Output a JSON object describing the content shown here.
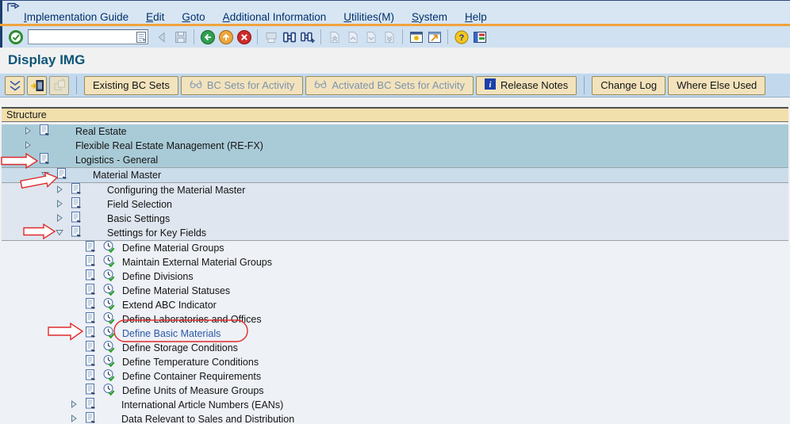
{
  "menubar": {
    "items": [
      "Implementation Guide",
      "Edit",
      "Goto",
      "Additional Information",
      "Utilities(M)",
      "System",
      "Help"
    ]
  },
  "toolbar": {
    "command_field": {
      "value": "",
      "placeholder": ""
    },
    "icon_names": [
      "enter-icon",
      "command-history-icon",
      "back-small-icon",
      "save-icon",
      "back-icon",
      "exit-icon",
      "cancel-icon",
      "print-icon",
      "find-icon",
      "find-next-icon",
      "first-page-icon",
      "previous-page-icon",
      "next-page-icon",
      "last-page-icon",
      "new-session-icon",
      "create-shortcut-icon",
      "help-icon",
      "customize-layout-icon"
    ]
  },
  "header": {
    "title": "Display IMG"
  },
  "app_toolbar": {
    "tools": [
      {
        "name": "choose",
        "icon": "double-chevron-down-icon",
        "disabled": false
      },
      {
        "name": "position",
        "icon": "position-window-icon",
        "disabled": false
      },
      {
        "name": "copy",
        "icon": "copy-icon",
        "disabled": true
      }
    ],
    "buttons": [
      {
        "label": "Existing BC Sets",
        "disabled": false
      },
      {
        "label": "BC Sets for Activity",
        "disabled": true,
        "icon": "glasses-icon"
      },
      {
        "label": "Activated BC Sets for Activity",
        "disabled": true,
        "icon": "glasses-icon"
      },
      {
        "label": "Release Notes",
        "disabled": false,
        "icon": "info-icon"
      },
      {
        "label": "Change Log",
        "disabled": false
      },
      {
        "label": "Where Else Used",
        "disabled": false
      }
    ]
  },
  "tree": {
    "header": "Structure",
    "bands": [
      {
        "rows": [
          {
            "label": "Real Estate",
            "level": 0,
            "expander": "collapsed",
            "icons": [
              "doc"
            ],
            "highlight": false
          },
          {
            "label": "Flexible Real Estate Management (RE-FX)",
            "level": 0,
            "expander": "collapsed",
            "icons": [],
            "highlight": false
          },
          {
            "label": "Logistics - General",
            "level": 0,
            "expander": "expanded",
            "icons": [
              "doc"
            ],
            "highlight": false
          }
        ]
      },
      {
        "rows": [
          {
            "label": "Material Master",
            "level": 1,
            "expander": "expanded",
            "icons": [
              "doc"
            ],
            "highlight": false
          }
        ]
      },
      {
        "rows": [
          {
            "label": "Configuring the Material Master",
            "level": 2,
            "expander": "collapsed",
            "icons": [
              "doc"
            ],
            "highlight": false
          },
          {
            "label": "Field Selection",
            "level": 2,
            "expander": "collapsed",
            "icons": [
              "doc"
            ],
            "highlight": false
          },
          {
            "label": "Basic Settings",
            "level": 2,
            "expander": "collapsed",
            "icons": [
              "doc"
            ],
            "highlight": false
          },
          {
            "label": "Settings for Key Fields",
            "level": 2,
            "expander": "expanded",
            "icons": [
              "doc"
            ],
            "highlight": false
          }
        ]
      },
      {
        "rows": [
          {
            "label": "Define Material Groups",
            "level": 3,
            "expander": null,
            "icons": [
              "doc",
              "exec"
            ],
            "highlight": false
          },
          {
            "label": "Maintain External Material Groups",
            "level": 3,
            "expander": null,
            "icons": [
              "doc",
              "exec"
            ],
            "highlight": false
          },
          {
            "label": "Define Divisions",
            "level": 3,
            "expander": null,
            "icons": [
              "doc",
              "exec"
            ],
            "highlight": false
          },
          {
            "label": "Define Material Statuses",
            "level": 3,
            "expander": null,
            "icons": [
              "doc",
              "exec"
            ],
            "highlight": false
          },
          {
            "label": "Extend ABC Indicator",
            "level": 3,
            "expander": null,
            "icons": [
              "doc",
              "exec"
            ],
            "highlight": false
          },
          {
            "label": "Define Laboratories and Offices",
            "level": 3,
            "expander": null,
            "icons": [
              "doc",
              "exec"
            ],
            "highlight": false
          },
          {
            "label": "Define Basic Materials",
            "level": 3,
            "expander": null,
            "icons": [
              "doc",
              "exec"
            ],
            "highlight": true
          },
          {
            "label": "Define Storage Conditions",
            "level": 3,
            "expander": null,
            "icons": [
              "doc",
              "exec"
            ],
            "highlight": false
          },
          {
            "label": "Define Temperature Conditions",
            "level": 3,
            "expander": null,
            "icons": [
              "doc",
              "exec"
            ],
            "highlight": false
          },
          {
            "label": "Define Container Requirements",
            "level": 3,
            "expander": null,
            "icons": [
              "doc",
              "exec"
            ],
            "highlight": false
          },
          {
            "label": "Define Units of Measure Groups",
            "level": 3,
            "expander": null,
            "icons": [
              "doc",
              "exec"
            ],
            "highlight": false
          },
          {
            "label": "International Article Numbers (EANs)",
            "level": 3,
            "expander": "collapsed",
            "icons": [
              "doc"
            ],
            "highlight": false
          },
          {
            "label": "Data Relevant to Sales and Distribution",
            "level": 3,
            "expander": "collapsed",
            "icons": [
              "doc"
            ],
            "highlight": false
          }
        ]
      }
    ]
  },
  "annotations": {
    "highlighted_item": "Define Basic Materials",
    "arrows_point_to": [
      "Logistics - General",
      "Material Master",
      "Settings for Key Fields",
      "Define Basic Materials"
    ],
    "oval_around": "Define Basic Materials"
  },
  "colors": {
    "menu_text": "#00306b",
    "orange_rule": "#f0a33c",
    "title": "#0e5577",
    "band_top": "#a9cbd7",
    "band_second": "#cbdcea",
    "band_third": "#dfe6ef",
    "band_leaf": "#eef1f6",
    "structure_header_bg": "#f2e0ac",
    "button_bg": "#f3e3bc",
    "disabled_text": "#7d93ad",
    "link_blue": "#2a5aa8",
    "annotation_red": "#e02b2b"
  }
}
